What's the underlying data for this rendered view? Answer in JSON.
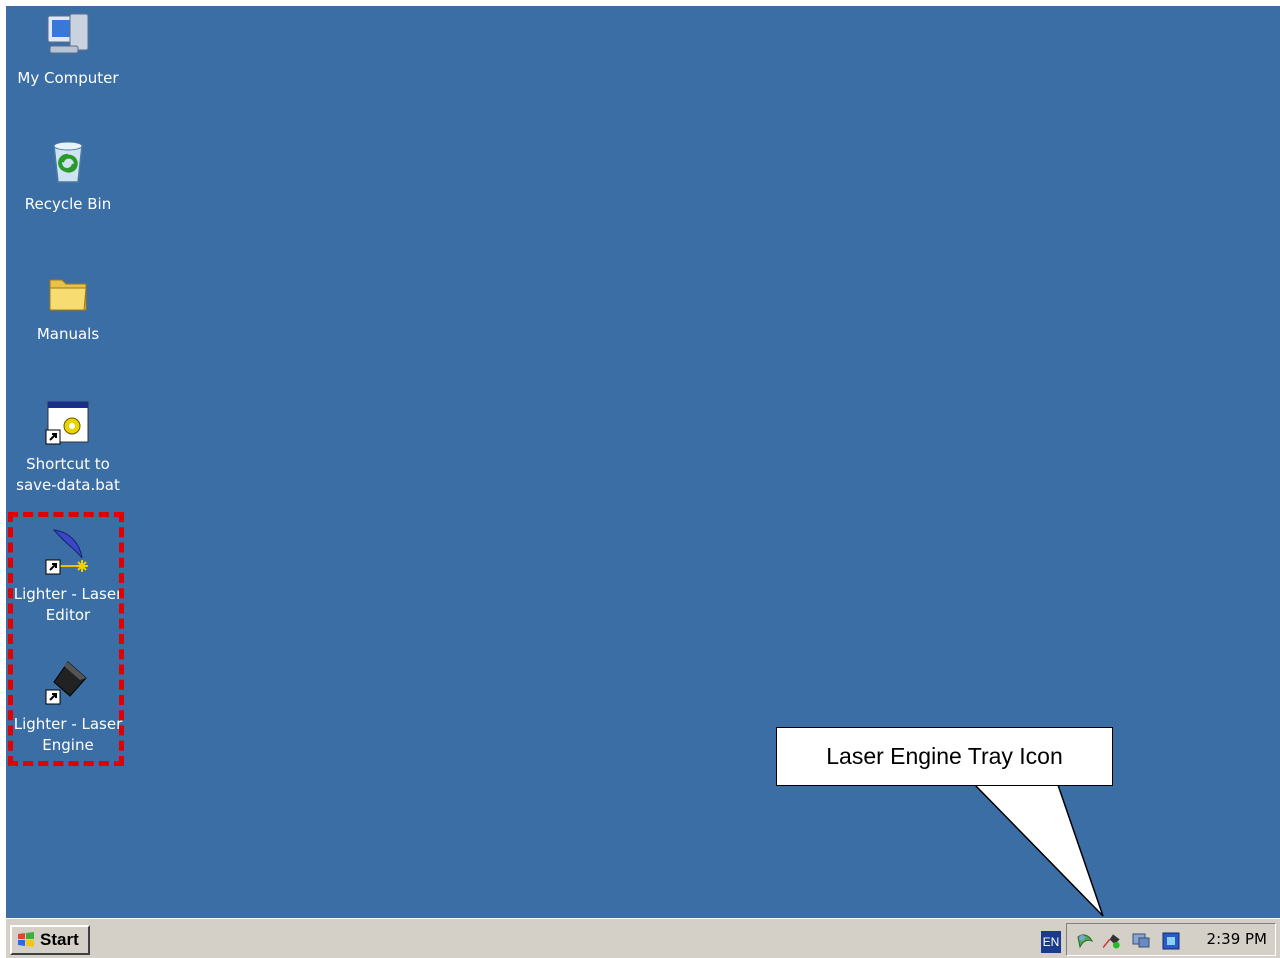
{
  "desktop": {
    "background_color": "#3b6ea5",
    "icons": [
      {
        "label": "My Computer",
        "icon": "my-computer-icon"
      },
      {
        "label": "Recycle Bin",
        "icon": "recycle-bin-icon"
      },
      {
        "label": "Manuals",
        "icon": "folder-icon"
      },
      {
        "label": "Shortcut to save-data.bat",
        "icon": "batch-file-shortcut-icon"
      },
      {
        "label": "Lighter - Laser Editor",
        "icon": "laser-editor-shortcut-icon"
      },
      {
        "label": "Lighter - Laser Engine",
        "icon": "laser-engine-shortcut-icon"
      }
    ]
  },
  "annotation": {
    "callout_text": "Laser Engine Tray Icon",
    "highlight_color": "#e00000"
  },
  "taskbar": {
    "start_label": "Start",
    "language": "EN",
    "tray_icons": [
      "network-icon",
      "laser-engine-tray-icon",
      "display-icon",
      "app-tray-icon"
    ],
    "clock": "2:39 PM"
  }
}
